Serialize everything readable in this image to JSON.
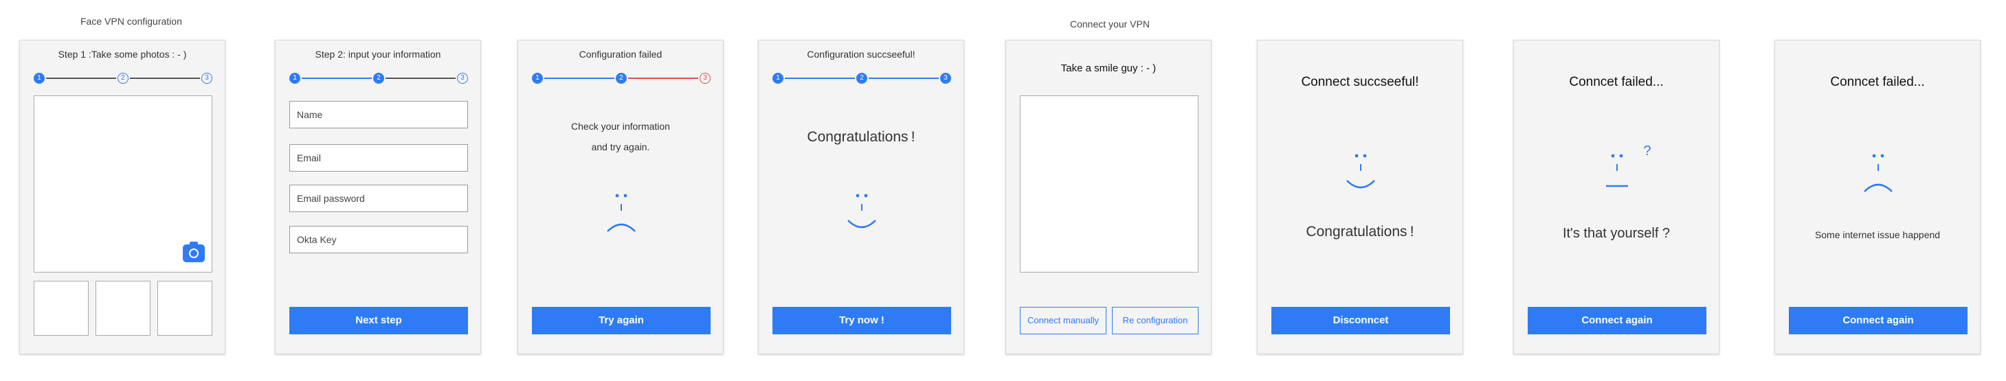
{
  "sections": {
    "face_vpn_title": "Face VPN configuration",
    "connect_vpn_title": "Connect your VPN"
  },
  "colors": {
    "accent": "#2f7bf6",
    "error": "#e05050",
    "card_bg": "#f4f4f4"
  },
  "steps": [
    "1",
    "2",
    "3"
  ],
  "step1": {
    "title": "Step 1 :Take some photos : - )",
    "camera_icon": "camera-icon"
  },
  "step2": {
    "title": "Step 2: input your information",
    "fields": {
      "name": "Name",
      "email": "Email",
      "email_password": "Email password",
      "okta_key": "Okta Key"
    },
    "button": "Next step"
  },
  "config_failed": {
    "title": "Configuration failed",
    "message_line1": "Check your information",
    "message_line2": "and try again.",
    "face_icon": "sad-face-icon",
    "button": "Try again"
  },
  "config_success": {
    "title": "Configuration succseeful!",
    "message": "Congratulations !",
    "face_icon": "smile-face-icon",
    "button": "Try now !"
  },
  "smile_capture": {
    "title": "Take a smile guy : - )",
    "manual_button": "Connect manually",
    "reconfig_button": "Re configuration"
  },
  "connect_success": {
    "title": "Connect succseeful!",
    "face_icon": "smile-face-icon",
    "message": "Congratulations !",
    "button": "Disconncet"
  },
  "connect_failed_identity": {
    "title": "Conncet failed...",
    "face_icon": "confused-face-icon",
    "question_mark": "?",
    "message": "It's that yourself ?",
    "button": "Connect again"
  },
  "connect_failed_network": {
    "title": "Conncet failed...",
    "face_icon": "sad-face-icon",
    "message": "Some internet issue happend",
    "button": "Connect again"
  }
}
